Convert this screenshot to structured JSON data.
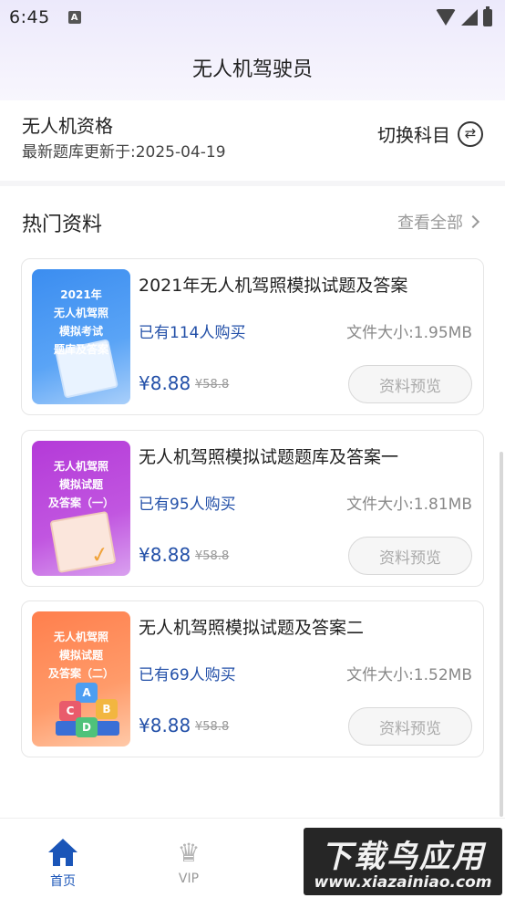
{
  "status_bar": {
    "time": "6:45",
    "notification_badge": "A"
  },
  "header": {
    "title": "无人机驾驶员"
  },
  "subject": {
    "name": "无人机资格",
    "update_text": "最新题库更新于:2025-04-19",
    "switch_label": "切换科目",
    "switch_icon": "swap-icon"
  },
  "section": {
    "title": "热门资料",
    "view_all": "查看全部"
  },
  "materials": [
    {
      "title": "2021年无人机驾照模拟试题及答案",
      "buyers": "已有114人购买",
      "size": "文件大小:1.95MB",
      "price": "¥8.88",
      "original_price": "¥58.8",
      "preview": "资料预览",
      "cover_text": "2021年\n无人机驾照\n模拟考试\n题库及答案",
      "cover_color": "#3b8df0"
    },
    {
      "title": "无人机驾照模拟试题题库及答案一",
      "buyers": "已有95人购买",
      "size": "文件大小:1.81MB",
      "price": "¥8.88",
      "original_price": "¥58.8",
      "preview": "资料预览",
      "cover_text": "无人机驾照\n模拟试题\n及答案（一）",
      "cover_color": "#b43ad8"
    },
    {
      "title": "无人机驾照模拟试题及答案二",
      "buyers": "已有69人购买",
      "size": "文件大小:1.52MB",
      "price": "¥8.88",
      "original_price": "¥58.8",
      "preview": "资料预览",
      "cover_text": "无人机驾照\n模拟试题\n及答案（二）",
      "cover_color": "#ff7f4d"
    }
  ],
  "cover3_blocks": [
    "A",
    "B",
    "C",
    "D"
  ],
  "bottom_nav": {
    "items": [
      {
        "label": "首页",
        "icon": "home-icon",
        "active": true
      },
      {
        "label": "VIP",
        "icon": "crown-icon",
        "active": false
      }
    ]
  },
  "watermark": {
    "main": "下载鸟应用",
    "url": "www.xiazainiao.com"
  },
  "colors": {
    "accent": "#1a55b8",
    "price": "#2350a8",
    "muted": "#999999"
  }
}
